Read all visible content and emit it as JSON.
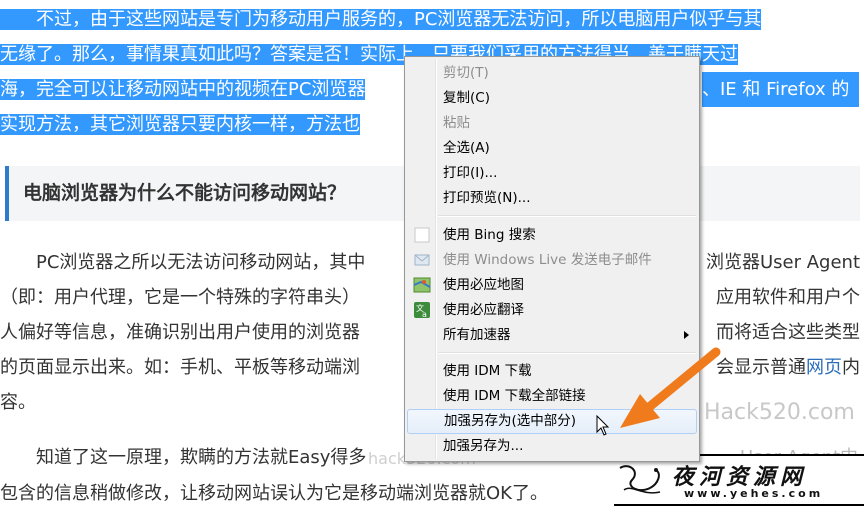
{
  "article": {
    "p1": [
      "　　不过，由于这些网站是专门为移动用户服务的，PC浏览器无法访问，所以电脑用户似乎与其",
      "无缘了。那么，事情果真如此吗？答案是否！实际上，只要我们采用的方法得当，善于瞒天过",
      "海，完全可以让移动网站中的视频在PC浏览器",
      "实现方法，其它浏览器只要内核一样，方法也"
    ],
    "p1_tail_line3": "、IE 和 Firefox 的",
    "heading": "电脑浏览器为什么不能访问移动网站？",
    "p2_left": [
      "　　PC浏览器之所以无法访问移动网站，其中",
      "（即：用户代理，它是一个特殊的字符串头）",
      "人偏好等信息，准确识别出用户使用的浏览器",
      "的页面显示出来。如：手机、平板等移动端浏",
      "容。"
    ],
    "p2_right": [
      "浏览器User Agent",
      "应用软件和用户个",
      "而将适合这些类型",
      "会显示普通"
    ],
    "p2_link": "网页",
    "p2_link_tail": "内",
    "p3_line1": "　　知道了这一原理，欺瞒的方法就Easy得多",
    "p3_line1_right": "User Agent中",
    "p3_line2": "包含的信息稍做修改，让移动网站误认为它是移动端浏览器就OK了。"
  },
  "watermarks": {
    "hack": "Hack520.com",
    "hack_small": "hack520.com"
  },
  "logo": {
    "title": "夜河资源网",
    "url": "www.yehes.com"
  },
  "context_menu": {
    "items": [
      {
        "label": "剪切(T)",
        "enabled": false,
        "icon": ""
      },
      {
        "label": "复制(C)",
        "enabled": true,
        "icon": ""
      },
      {
        "label": "粘贴",
        "enabled": false,
        "icon": ""
      },
      {
        "label": "全选(A)",
        "enabled": true,
        "icon": ""
      },
      {
        "label": "打印(I)...",
        "enabled": true,
        "icon": ""
      },
      {
        "label": "打印预览(N)...",
        "enabled": true,
        "icon": ""
      },
      {
        "label": "使用 Bing 搜索",
        "enabled": true,
        "icon": "bing-icon"
      },
      {
        "label": "使用 Windows Live 发送电子邮件",
        "enabled": false,
        "icon": "windows-live-mail-icon"
      },
      {
        "label": "使用必应地图",
        "enabled": true,
        "icon": "bing-maps-icon"
      },
      {
        "label": "使用必应翻译",
        "enabled": true,
        "icon": "bing-translate-icon"
      },
      {
        "label": "所有加速器",
        "enabled": true,
        "icon": "",
        "submenu": true
      },
      {
        "label": "使用 IDM 下载",
        "enabled": true,
        "icon": ""
      },
      {
        "label": "使用 IDM 下载全部链接",
        "enabled": true,
        "icon": ""
      },
      {
        "label": "加强另存为(选中部分)",
        "enabled": true,
        "icon": "",
        "highlighted": true
      },
      {
        "label": "加强另存为...",
        "enabled": true,
        "icon": ""
      }
    ]
  },
  "colors": {
    "selection": "#3399ff",
    "accent_arrow": "#f07b1d",
    "link": "#2a6ebb",
    "heading_bar": "#2c7ccb"
  }
}
